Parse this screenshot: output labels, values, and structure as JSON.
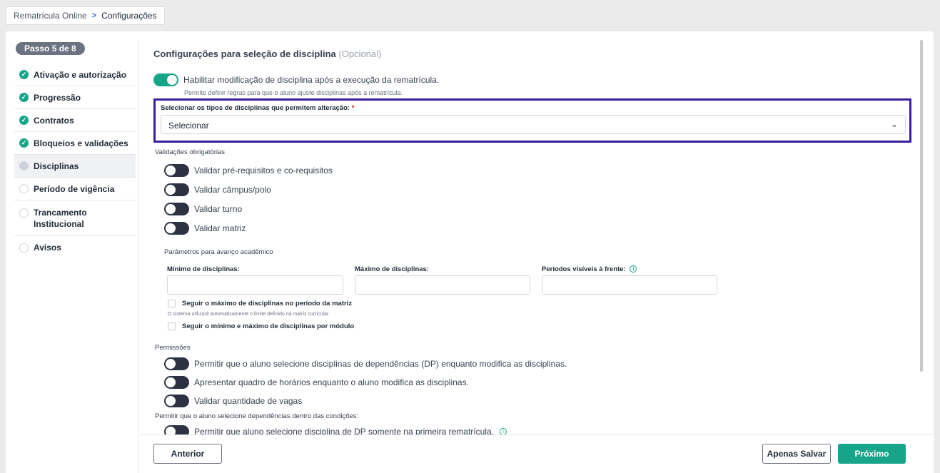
{
  "breadcrumb": {
    "parent": "Rematrícula Online",
    "current": "Configurações"
  },
  "sidebar": {
    "step_badge": "Passo 5 de 8",
    "steps": [
      {
        "label": "Ativação e autorização",
        "status": "done"
      },
      {
        "label": "Progressão",
        "status": "done"
      },
      {
        "label": "Contratos",
        "status": "done"
      },
      {
        "label": "Bloqueios e validações",
        "status": "done"
      },
      {
        "label": "Disciplinas",
        "status": "current"
      },
      {
        "label": "Período de vigência",
        "status": "pending"
      },
      {
        "label": "Trancamento Institucional",
        "status": "pending"
      },
      {
        "label": "Avisos",
        "status": "pending"
      }
    ]
  },
  "main": {
    "title": "Configurações para seleção de disciplina",
    "title_optional": "(Opcional)",
    "enable_toggle": {
      "label": "Habilitar modificação de disciplina após a execução da rematrícula.",
      "on": true
    },
    "enable_hint": "Permite definir regras para que o aluno ajuste disciplinas após a rematrícula.",
    "select": {
      "label": "Selecionar os tipos de disciplinas que permitem alteração:",
      "required_mark": "*",
      "value": "Selecionar"
    },
    "validations_heading": "Validações obrigatórias",
    "validations": [
      {
        "label": "Validar pré-requisitos e co-requisitos",
        "on": false
      },
      {
        "label": "Validar câmpus/polo",
        "on": false
      },
      {
        "label": "Validar turno",
        "on": false
      },
      {
        "label": "Validar matriz",
        "on": false
      }
    ],
    "params_heading": "Parâmetros para avanço acadêmico",
    "min_label": "Mínimo de disciplinas:",
    "min_value": "",
    "max_label": "Máximo de disciplinas:",
    "max_value": "",
    "periods_label": "Períodos visíveis à frente:",
    "periods_value": "",
    "check_follow_max": {
      "label": "Seguir o máximo de disciplinas no período da matriz",
      "checked": false
    },
    "check_follow_max_hint": "O sistema utilizará automaticamente o limite definido na matriz curricular.",
    "check_min_max_module": {
      "label": "Seguir o mínimo e máximo de disciplinas por módulo",
      "checked": false
    },
    "permissions_heading": "Permissões",
    "permissions": [
      {
        "label": "Permitir que o aluno selecione disciplinas de dependências (DP) enquanto modifica as disciplinas.",
        "on": false
      },
      {
        "label": "Apresentar quadro de horários enquanto o aluno modifica as disciplinas.",
        "on": false
      },
      {
        "label": "Validar quantidade de vagas",
        "on": false
      }
    ],
    "dependencies_heading": "Permitir que o aluno selecione dependências dentro das condições:",
    "dependencies_toggle": {
      "label": "Permitir que aluno selecione disciplina de DP somente na primeira rematrícula.",
      "on": false
    }
  },
  "footer": {
    "previous": "Anterior",
    "save_only": "Apenas Salvar",
    "next": "Próximo"
  },
  "colors": {
    "accent": "#17a589",
    "toggle_off": "#2d3243",
    "highlight": "#3a1d9e"
  }
}
